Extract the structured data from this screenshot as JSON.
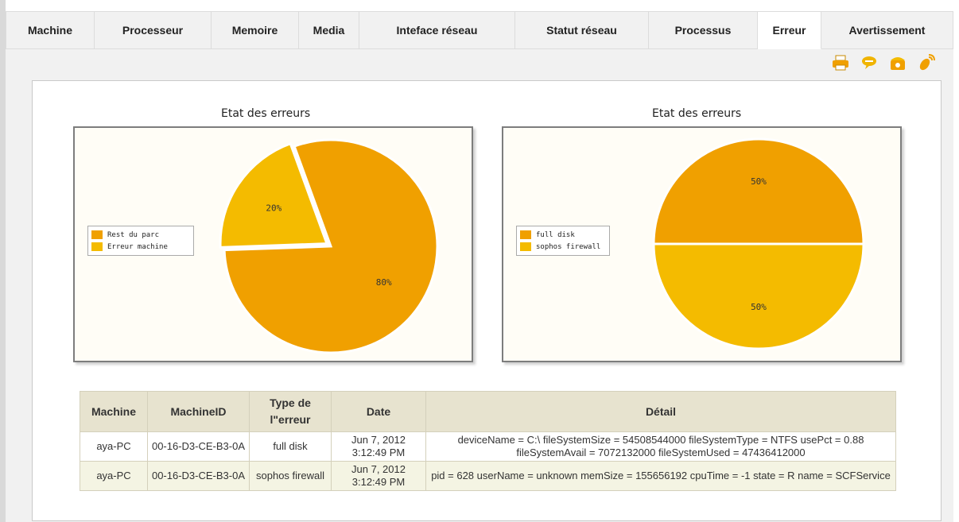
{
  "tabs": [
    {
      "label": "Machine",
      "active": false
    },
    {
      "label": "Processeur",
      "active": false
    },
    {
      "label": "Memoire",
      "active": false
    },
    {
      "label": "Media",
      "active": false
    },
    {
      "label": "Inteface réseau",
      "active": false
    },
    {
      "label": "Statut réseau",
      "active": false
    },
    {
      "label": "Processus",
      "active": false
    },
    {
      "label": "Erreur",
      "active": true
    },
    {
      "label": "Avertissement",
      "active": false
    }
  ],
  "toolbar": {
    "icons": [
      "printer-icon",
      "chat-icon",
      "phone-icon",
      "satellite-icon"
    ]
  },
  "colors": {
    "slice_primary": "#f0a000",
    "slice_secondary": "#f4bb00",
    "table_header": "#e7e3cf"
  },
  "chart_data": [
    {
      "type": "pie",
      "title": "Etat des erreurs",
      "labels": [
        "Rest du parc",
        "Erreur machine"
      ],
      "values": [
        80,
        20
      ],
      "value_labels": [
        "80%",
        "20%"
      ],
      "legend": "left"
    },
    {
      "type": "pie",
      "title": "Etat des erreurs",
      "labels": [
        "full disk",
        "sophos firewall"
      ],
      "values": [
        50,
        50
      ],
      "value_labels": [
        "50%",
        "50%"
      ],
      "legend": "left"
    }
  ],
  "table": {
    "headers": [
      "Machine",
      "MachineID",
      "Type de l\"erreur",
      "Date",
      "Détail"
    ],
    "rows": [
      {
        "machine": "aya-PC",
        "machine_id": "00-16-D3-CE-B3-0A",
        "type": "full disk",
        "date": "Jun 7, 2012 3:12:49 PM",
        "detail": "deviceName = C:\\ fileSystemSize = 54508544000 fileSystemType = NTFS usePct = 0.88 fileSystemAvail = 7072132000 fileSystemUsed = 47436412000"
      },
      {
        "machine": "aya-PC",
        "machine_id": "00-16-D3-CE-B3-0A",
        "type": "sophos firewall",
        "date": "Jun 7, 2012 3:12:49 PM",
        "detail": "pid = 628 userName = unknown memSize = 155656192 cpuTime = -1 state = R name = SCFService"
      }
    ]
  }
}
